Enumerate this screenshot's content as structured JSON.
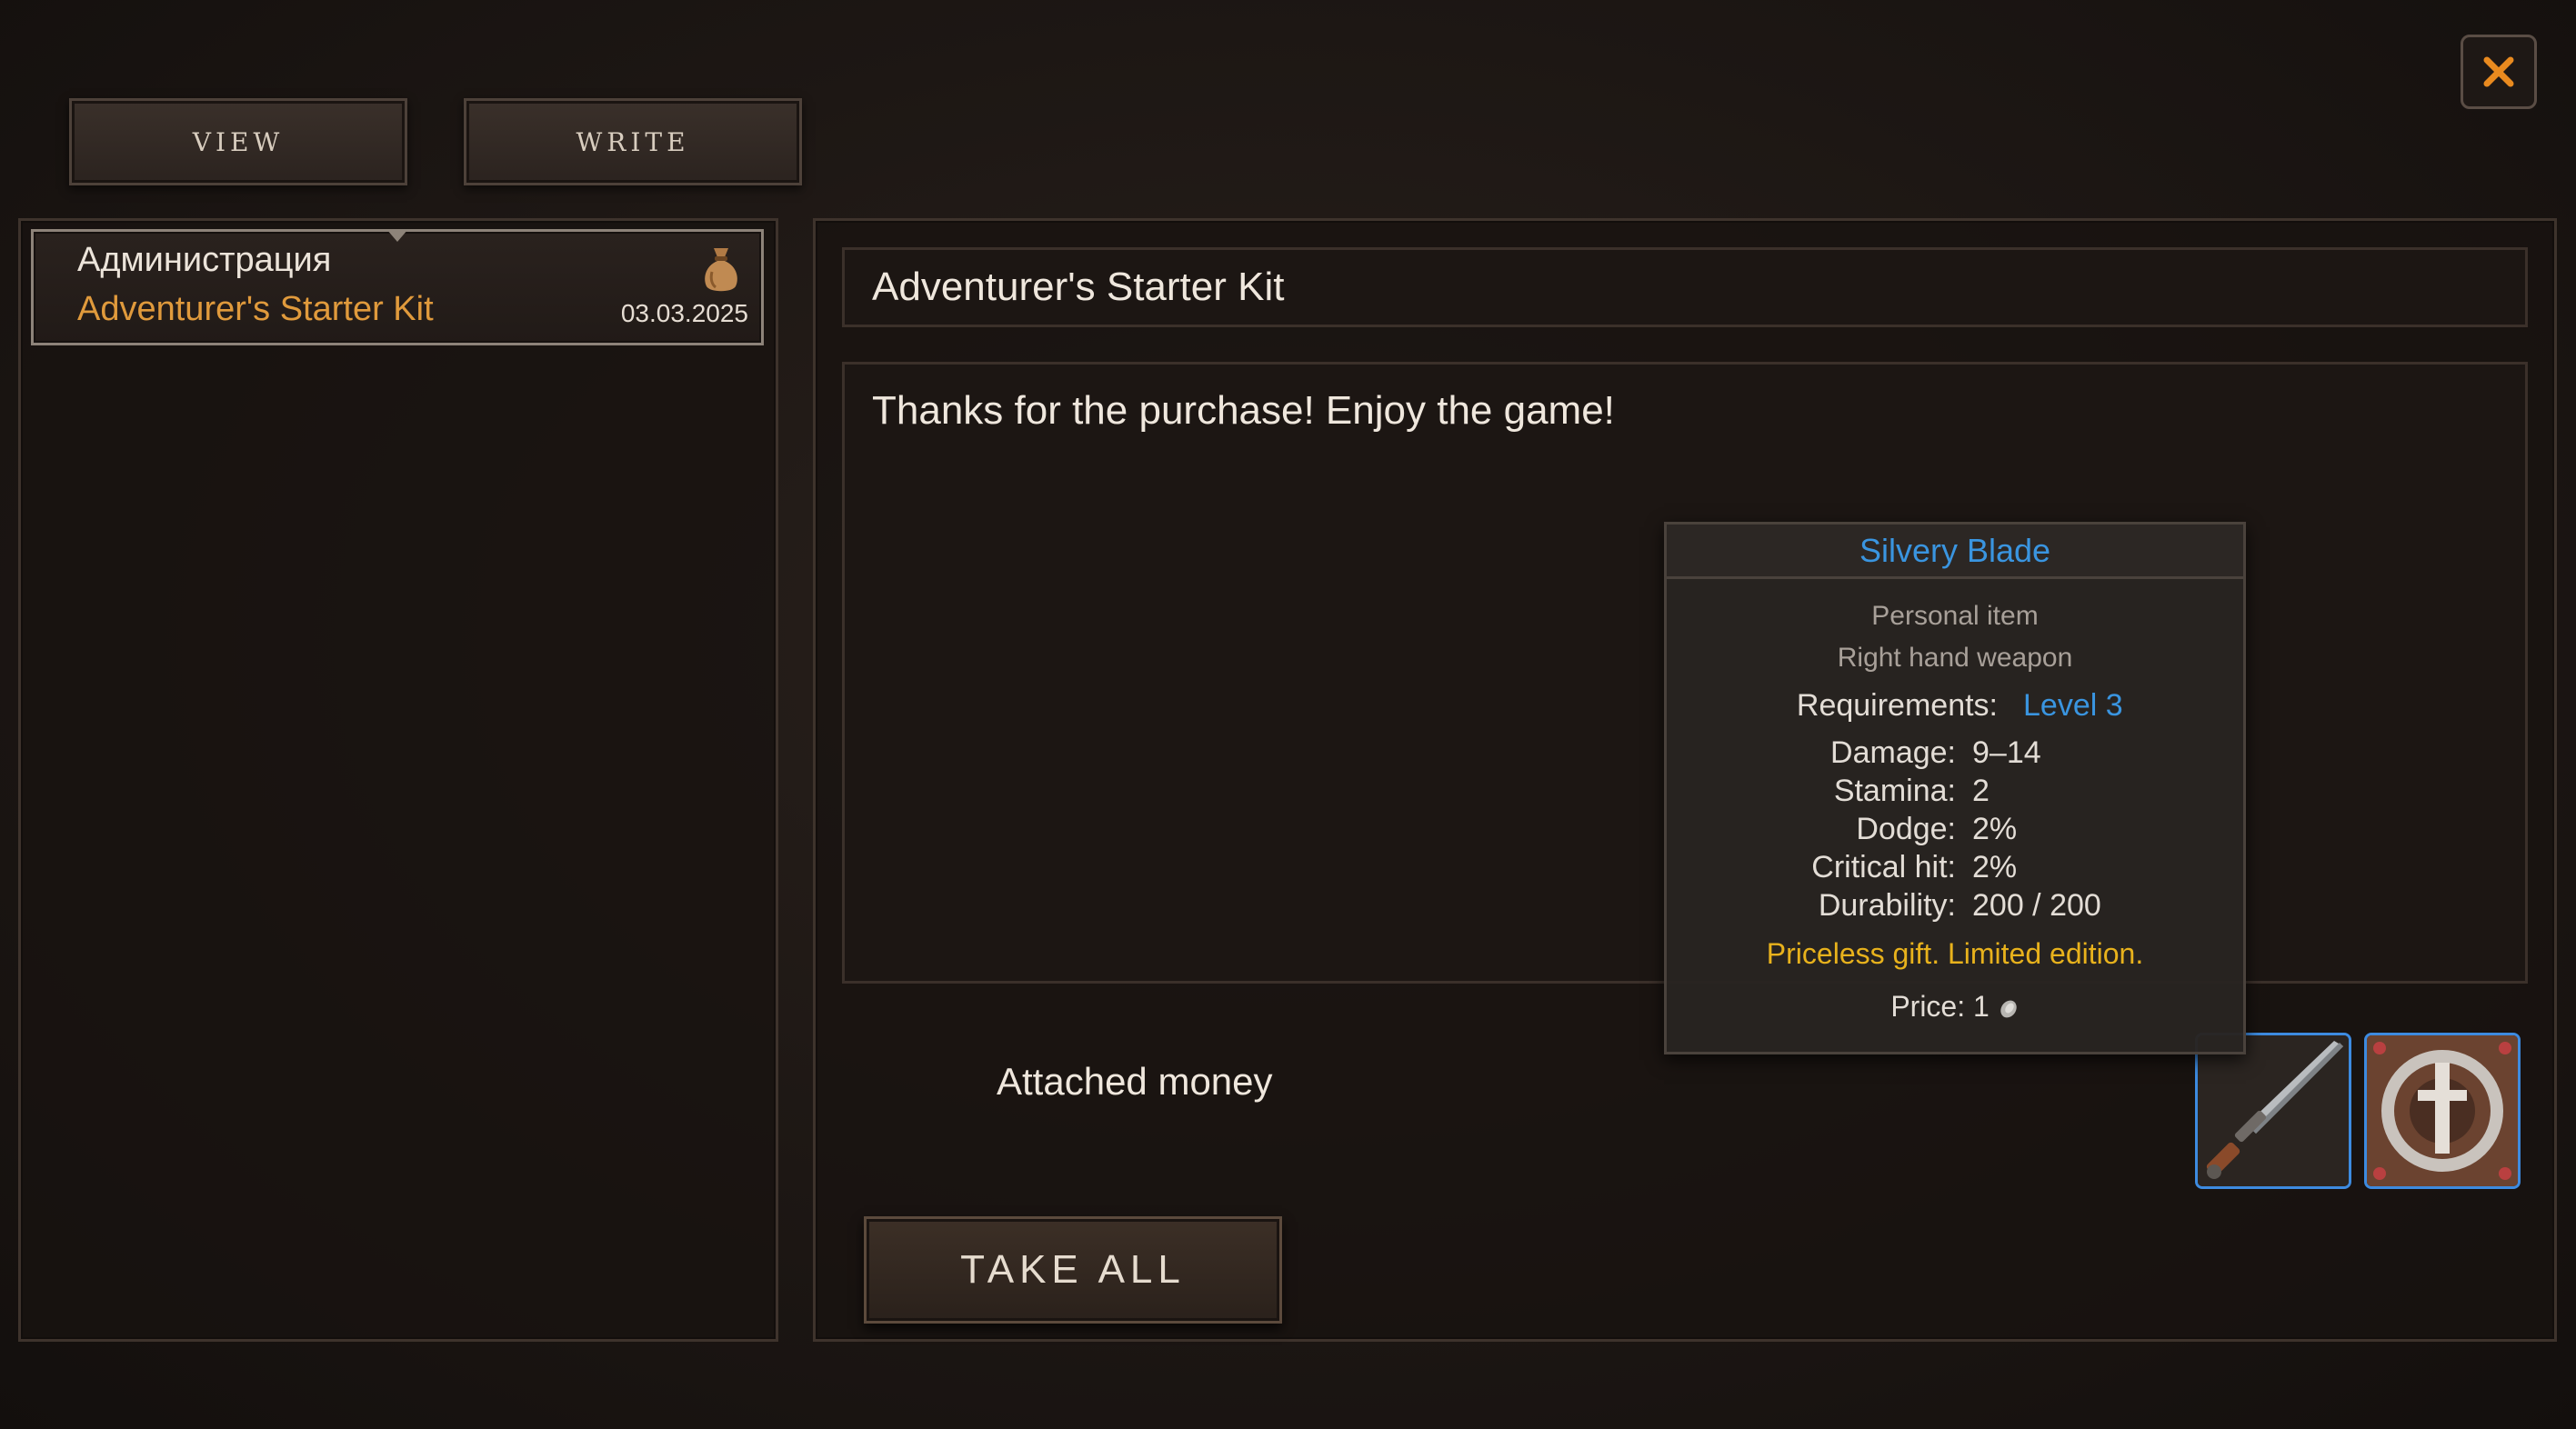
{
  "tabs": {
    "view": "VIEW",
    "write": "WRITE"
  },
  "close_icon": "close-x-icon",
  "mail_list": {
    "items": [
      {
        "sender": "Администрация",
        "subject": "Adventurer's Starter Kit",
        "date": "03.03.2025",
        "icon": "money-bag-icon"
      }
    ]
  },
  "mail": {
    "subject": "Adventurer's Starter Kit",
    "body": "Thanks for the purchase! Enjoy the game!",
    "attached_money_label": "Attached money",
    "take_all_label": "TAKE ALL",
    "attachments": [
      {
        "icon": "silvery-blade-icon"
      },
      {
        "icon": "sword-emblem-icon"
      }
    ]
  },
  "tooltip": {
    "title": "Silvery Blade",
    "personal": "Personal item",
    "slot": "Right hand weapon",
    "requirements_label": "Requirements:",
    "requirements_value": "Level 3",
    "stats": [
      {
        "label": "Damage:",
        "value": "9–14"
      },
      {
        "label": "Stamina:",
        "value": "2"
      },
      {
        "label": "Dodge:",
        "value": "2%"
      },
      {
        "label": "Critical hit:",
        "value": "2%"
      },
      {
        "label": "Durability:",
        "value": "200 / 200"
      }
    ],
    "note": "Priceless gift. Limited edition.",
    "price_label": "Price:",
    "price_value": "1",
    "price_icon": "silver-coin-icon"
  },
  "colors": {
    "accent_orange": "#e09a3c",
    "accent_blue": "#3a95e0",
    "gold_text": "#e8b21c",
    "close_x": "#e98a1f"
  }
}
